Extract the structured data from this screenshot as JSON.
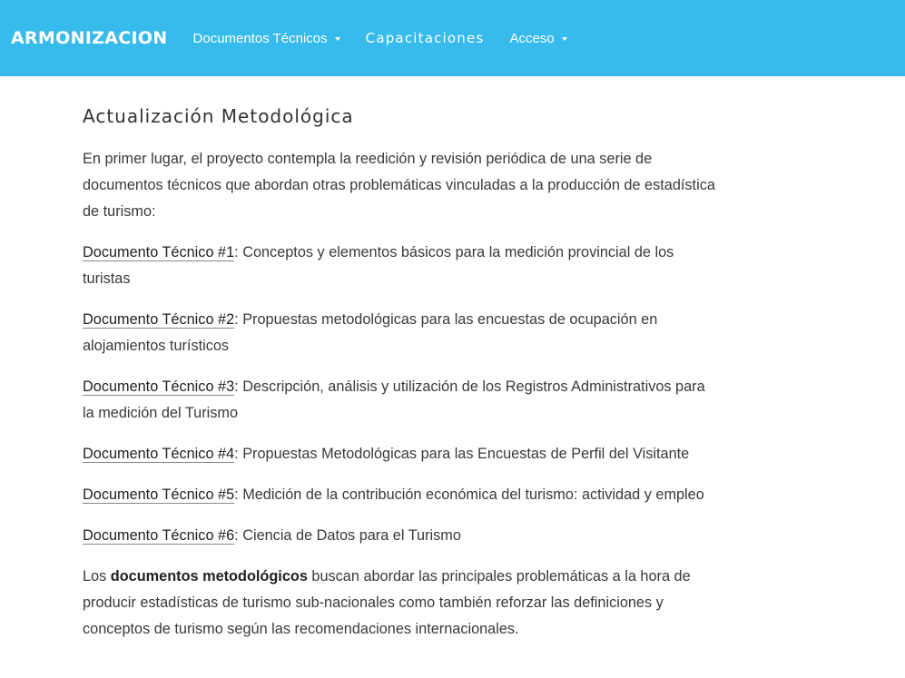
{
  "nav": {
    "brand": "ARMONIZACION",
    "items": [
      {
        "label": "Documentos Técnicos",
        "dropdown": true
      },
      {
        "label": "Capacitaciones",
        "dropdown": false
      },
      {
        "label": "Acceso",
        "dropdown": true
      }
    ]
  },
  "colors": {
    "nav_bg": "#37bbec",
    "text": "#3a3a3a"
  },
  "main": {
    "title": "Actualización Metodológica",
    "intro": "En primer lugar, el proyecto contempla la reedición y revisión periódica de una serie de documentos técnicos que abordan otras problemáticas vinculadas a la producción de estadística de turismo:",
    "docs": [
      {
        "link": "Documento Técnico #1",
        "desc": ": Conceptos y elementos básicos para la medición provincial de los turistas"
      },
      {
        "link": "Documento Técnico #2",
        "desc": ": Propuestas metodológicas para las encuestas de ocupación en alojamientos turísticos"
      },
      {
        "link": "Documento Técnico #3",
        "desc": ": Descripción, análisis y utilización de los Registros Administrativos para la medición del Turismo"
      },
      {
        "link": "Documento Técnico #4",
        "desc": ": Propuestas Metodológicas para las Encuestas de Perfil del Visitante"
      },
      {
        "link": "Documento Técnico #5",
        "desc": ": Medición de la contribución económica del turismo: actividad y empleo"
      },
      {
        "link": "Documento Técnico #6",
        "desc": ": Ciencia de Datos para el Turismo"
      }
    ],
    "closing": {
      "prefix": "Los ",
      "bold": "documentos metodológicos",
      "rest": " buscan abordar las principales problemáticas a la hora de producir estadísticas de turismo sub-nacionales como también reforzar las definiciones y conceptos de turismo según las recomendaciones internacionales."
    }
  }
}
